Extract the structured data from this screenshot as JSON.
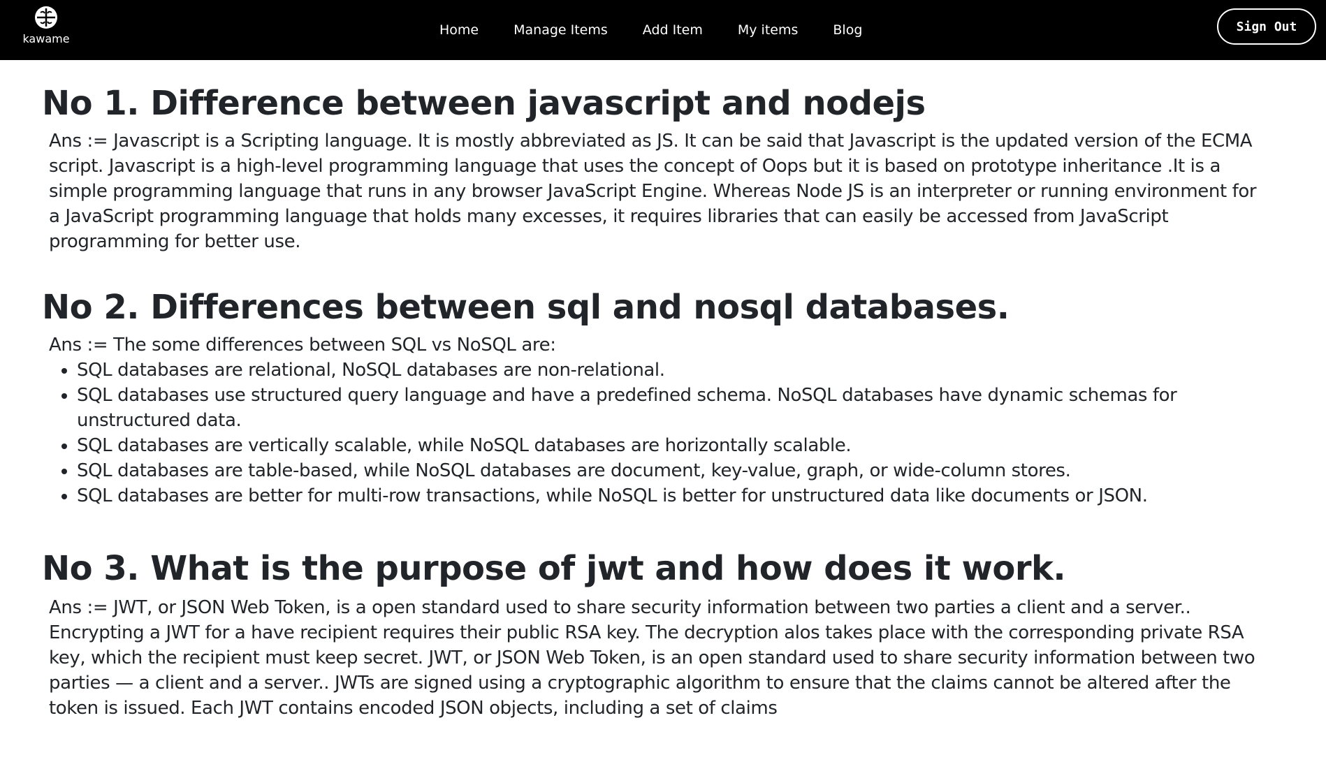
{
  "nav": {
    "brand_name": "kawame",
    "links": [
      {
        "label": "Home"
      },
      {
        "label": "Manage Items"
      },
      {
        "label": "Add Item"
      },
      {
        "label": "My items"
      },
      {
        "label": "Blog"
      }
    ],
    "sign_out_label": "Sign Out"
  },
  "questions": [
    {
      "title": "No 1. Difference between javascript and nodejs",
      "answer": "Ans := Javascript is a Scripting language. It is mostly abbreviated as JS. It can be said that Javascript is the updated version of the ECMA script. Javascript is a high-level programming language that uses the concept of Oops but it is based on prototype inheritance .It is a simple programming language that runs in any browser JavaScript Engine. Whereas Node JS is an interpreter or running environment for a JavaScript programming language that holds many excesses, it requires libraries that can easily be accessed from JavaScript programming for better use."
    },
    {
      "title": "No 2. Differences between sql and nosql databases.",
      "answer": "Ans := The some differences between SQL vs NoSQL are:",
      "points": [
        "SQL databases are relational, NoSQL databases are non-relational.",
        "SQL databases use structured query language and have a predefined schema. NoSQL databases have dynamic schemas for unstructured data.",
        "SQL databases are vertically scalable, while NoSQL databases are horizontally scalable.",
        "SQL databases are table-based, while NoSQL databases are document, key-value, graph, or wide-column stores.",
        "SQL databases are better for multi-row transactions, while NoSQL is better for unstructured data like documents or JSON."
      ]
    },
    {
      "title": "No 3. What is the purpose of jwt and how does it work.",
      "answer": "Ans := JWT, or JSON Web Token, is a open standard used to share security information between two parties a client and a server.. Encrypting a JWT for a have recipient requires their public RSA key. The decryption alos takes place with the corresponding private RSA key, which the recipient must keep secret. JWT, or JSON Web Token, is an open standard used to share security information between two parties — a client and a server.. JWTs are signed using a cryptographic algorithm to ensure that the claims cannot be altered after the token is issued. Each JWT contains encoded JSON objects, including a set of claims"
    }
  ]
}
